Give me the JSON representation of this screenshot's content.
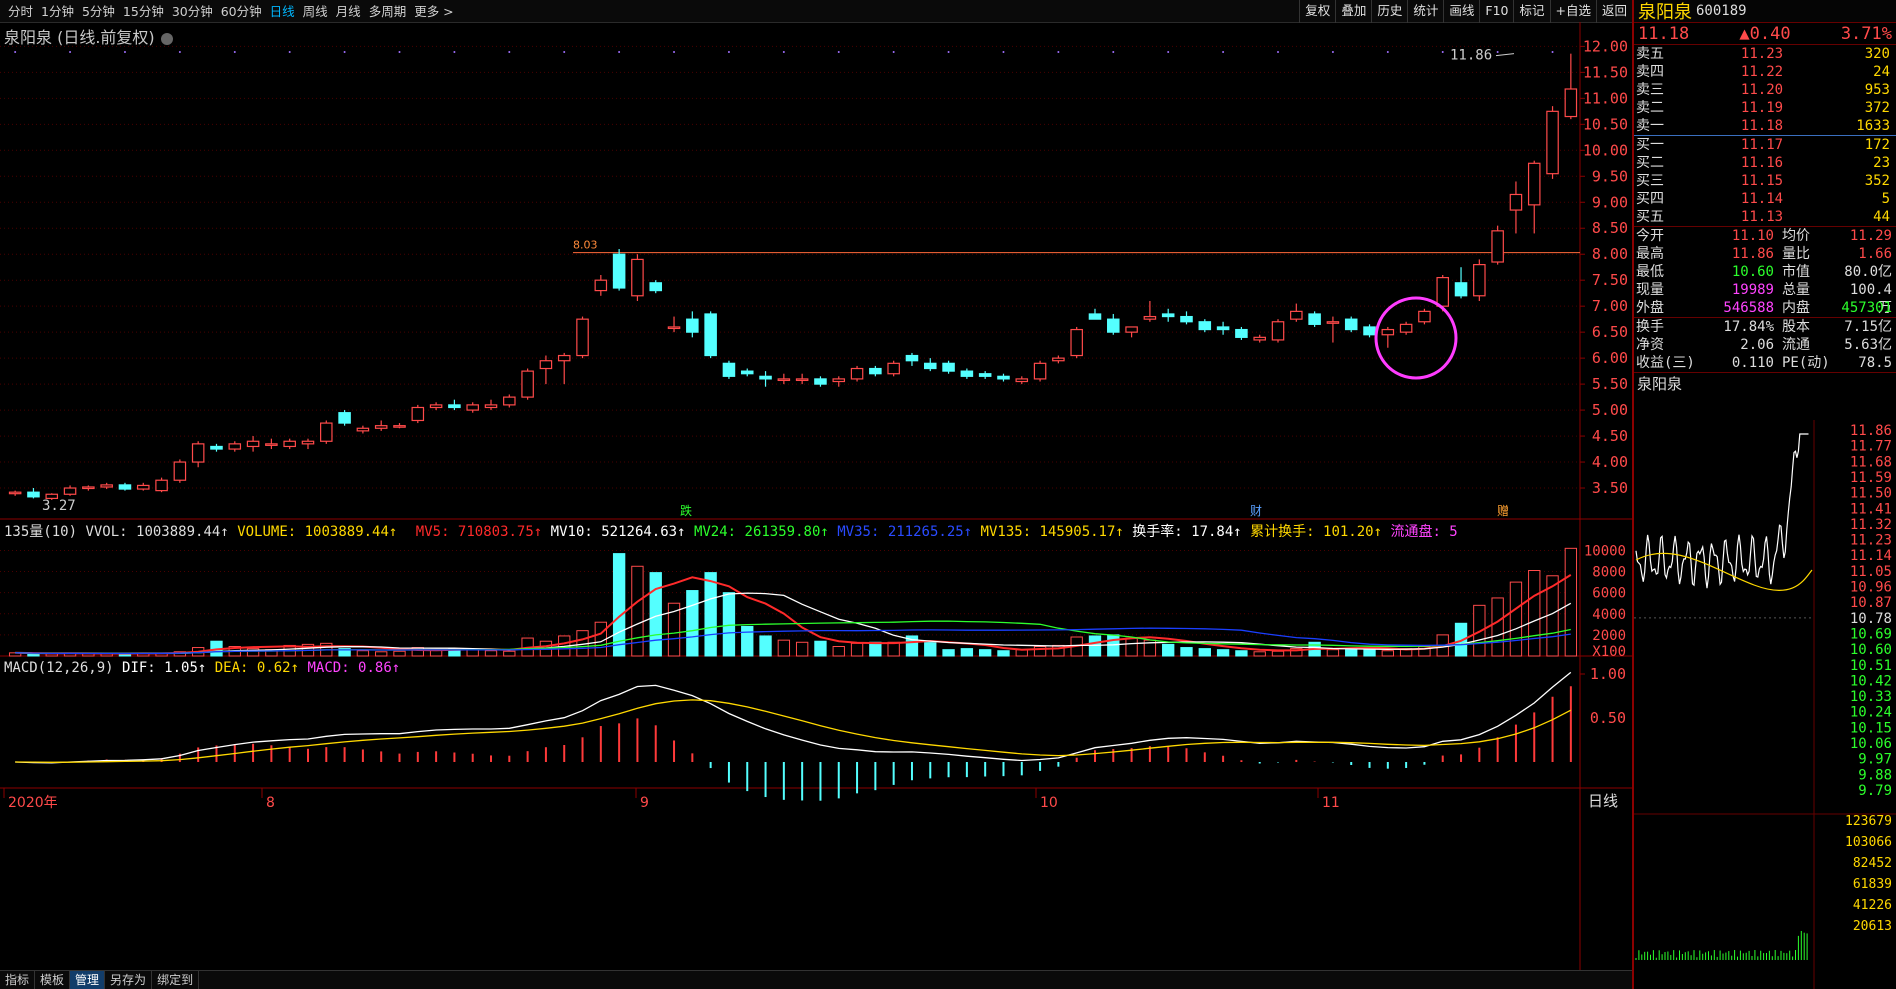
{
  "toolbar": {
    "periods": [
      "分时",
      "1分钟",
      "5分钟",
      "15分钟",
      "30分钟",
      "60分钟",
      "日线",
      "周线",
      "月线",
      "多周期",
      "更多"
    ],
    "active_period": "日线",
    "right_buttons": [
      "复权",
      "叠加",
      "历史",
      "统计",
      "画线",
      "F10",
      "标记",
      "+自选",
      "返回"
    ]
  },
  "chart_title": "泉阳泉 (日线.前复权)",
  "colors": {
    "up": "#ff4a4a",
    "down": "#54ffff",
    "ma5": "#ff2a2a",
    "ma10": "#ffffff",
    "ma24": "#2cff2c",
    "ma35": "#1a3fff",
    "ma135": "#ffd800",
    "macd": "#ff3a3a"
  },
  "price_axis": [
    "12.00",
    "11.50",
    "11.00",
    "10.50",
    "10.00",
    "9.50",
    "9.00",
    "8.50",
    "8.00",
    "7.50",
    "7.00",
    "6.50",
    "6.00",
    "5.50",
    "5.00",
    "4.50",
    "4.00",
    "3.50"
  ],
  "annotations": {
    "high_label": "11.86",
    "low_label": "3.27",
    "line_label": "8.03",
    "event_markers": [
      "跌",
      "财",
      "赠"
    ]
  },
  "volume_bar": {
    "name": "135量(10)",
    "vvol": "VVOL: 1003889.44↑",
    "volume": "VOLUME: 1003889.44↑",
    "mv5": "MV5: 710803.75↑",
    "mv10": "MV10: 521264.63↑",
    "mv24": "MV24: 261359.80↑",
    "mv35": "MV35: 211265.25↑",
    "mv135": "MV135: 145905.17↑",
    "turnover": "换手率: 17.84↑",
    "cum_turnover": "累计换手: 101.20↑",
    "float": "流通盘: 5"
  },
  "volume_axis": [
    "10000",
    "8000",
    "6000",
    "4000",
    "2000",
    "X100"
  ],
  "macd_bar": {
    "name": "MACD(12,26,9)",
    "dif": "DIF: 1.05↑",
    "dea": "DEA: 0.62↑",
    "macd": "MACD: 0.86↑"
  },
  "macd_axis": [
    "1.00",
    "0.50"
  ],
  "time_axis": [
    "2020年",
    "8",
    "9",
    "10",
    "11"
  ],
  "bottom_tabs": [
    "指标",
    "模板",
    "管理",
    "另存为",
    "绑定到"
  ],
  "period_label": "日线",
  "chart_data": {
    "type": "candlestick",
    "dates_start": "2020-07",
    "candles": [
      [
        3.4,
        3.45,
        3.35,
        3.42
      ],
      [
        3.42,
        3.5,
        3.3,
        3.33
      ],
      [
        3.3,
        3.4,
        3.27,
        3.38
      ],
      [
        3.38,
        3.55,
        3.35,
        3.5
      ],
      [
        3.5,
        3.55,
        3.45,
        3.52
      ],
      [
        3.52,
        3.6,
        3.48,
        3.56
      ],
      [
        3.56,
        3.6,
        3.45,
        3.48
      ],
      [
        3.48,
        3.6,
        3.45,
        3.55
      ],
      [
        3.45,
        3.7,
        3.42,
        3.65
      ],
      [
        3.65,
        4.05,
        3.6,
        4.0
      ],
      [
        4.0,
        4.4,
        3.9,
        4.35
      ],
      [
        4.3,
        4.35,
        4.2,
        4.25
      ],
      [
        4.25,
        4.4,
        4.2,
        4.35
      ],
      [
        4.3,
        4.5,
        4.2,
        4.4
      ],
      [
        4.35,
        4.45,
        4.25,
        4.35
      ],
      [
        4.3,
        4.45,
        4.25,
        4.4
      ],
      [
        4.35,
        4.45,
        4.25,
        4.4
      ],
      [
        4.4,
        4.8,
        4.35,
        4.75
      ],
      [
        4.95,
        5.0,
        4.7,
        4.75
      ],
      [
        4.6,
        4.7,
        4.55,
        4.65
      ],
      [
        4.65,
        4.8,
        4.6,
        4.7
      ],
      [
        4.7,
        4.75,
        4.65,
        4.7
      ],
      [
        4.8,
        5.1,
        4.75,
        5.05
      ],
      [
        5.05,
        5.15,
        5.0,
        5.1
      ],
      [
        5.1,
        5.2,
        5.0,
        5.05
      ],
      [
        5.0,
        5.15,
        4.95,
        5.1
      ],
      [
        5.05,
        5.2,
        5.0,
        5.1
      ],
      [
        5.1,
        5.3,
        5.05,
        5.25
      ],
      [
        5.25,
        5.8,
        5.2,
        5.75
      ],
      [
        5.8,
        6.05,
        5.5,
        5.95
      ],
      [
        5.95,
        6.1,
        5.5,
        6.05
      ],
      [
        6.05,
        6.8,
        6.0,
        6.75
      ],
      [
        7.3,
        7.6,
        7.2,
        7.5
      ],
      [
        8.0,
        8.1,
        7.3,
        7.35
      ],
      [
        7.2,
        8.0,
        7.1,
        7.9
      ],
      [
        7.45,
        7.5,
        7.25,
        7.3
      ],
      [
        6.6,
        6.8,
        6.5,
        6.6
      ],
      [
        6.75,
        6.9,
        6.4,
        6.5
      ],
      [
        6.85,
        6.9,
        6.0,
        6.05
      ],
      [
        5.9,
        5.95,
        5.6,
        5.65
      ],
      [
        5.75,
        5.8,
        5.65,
        5.7
      ],
      [
        5.65,
        5.75,
        5.45,
        5.6
      ],
      [
        5.6,
        5.7,
        5.5,
        5.6
      ],
      [
        5.6,
        5.7,
        5.5,
        5.6
      ],
      [
        5.6,
        5.65,
        5.45,
        5.5
      ],
      [
        5.55,
        5.65,
        5.45,
        5.6
      ],
      [
        5.6,
        5.85,
        5.55,
        5.8
      ],
      [
        5.8,
        5.85,
        5.65,
        5.7
      ],
      [
        5.7,
        5.95,
        5.65,
        5.9
      ],
      [
        6.05,
        6.1,
        5.85,
        5.95
      ],
      [
        5.9,
        6.0,
        5.75,
        5.8
      ],
      [
        5.9,
        5.95,
        5.7,
        5.75
      ],
      [
        5.75,
        5.8,
        5.6,
        5.65
      ],
      [
        5.7,
        5.75,
        5.6,
        5.65
      ],
      [
        5.65,
        5.7,
        5.55,
        5.6
      ],
      [
        5.55,
        5.65,
        5.5,
        5.6
      ],
      [
        5.6,
        5.95,
        5.55,
        5.9
      ],
      [
        5.95,
        6.05,
        5.9,
        6.0
      ],
      [
        6.05,
        6.6,
        6.0,
        6.55
      ],
      [
        6.85,
        6.95,
        6.75,
        6.75
      ],
      [
        6.75,
        6.85,
        6.45,
        6.5
      ],
      [
        6.5,
        6.6,
        6.4,
        6.6
      ],
      [
        6.75,
        7.1,
        6.7,
        6.8
      ],
      [
        6.85,
        6.95,
        6.7,
        6.8
      ],
      [
        6.8,
        6.9,
        6.65,
        6.7
      ],
      [
        6.7,
        6.75,
        6.5,
        6.55
      ],
      [
        6.6,
        6.7,
        6.45,
        6.55
      ],
      [
        6.55,
        6.6,
        6.35,
        6.4
      ],
      [
        6.35,
        6.45,
        6.3,
        6.4
      ],
      [
        6.35,
        6.75,
        6.3,
        6.7
      ],
      [
        6.75,
        7.05,
        6.7,
        6.9
      ],
      [
        6.85,
        6.9,
        6.6,
        6.65
      ],
      [
        6.7,
        6.8,
        6.3,
        6.7
      ],
      [
        6.75,
        6.8,
        6.5,
        6.55
      ],
      [
        6.6,
        6.65,
        6.4,
        6.45
      ],
      [
        6.45,
        6.6,
        6.2,
        6.55
      ],
      [
        6.5,
        6.7,
        6.45,
        6.65
      ],
      [
        6.7,
        6.95,
        6.65,
        6.9
      ],
      [
        7.0,
        7.6,
        6.9,
        7.55
      ],
      [
        7.45,
        7.75,
        7.15,
        7.2
      ],
      [
        7.2,
        7.9,
        7.1,
        7.8
      ],
      [
        7.85,
        8.55,
        7.8,
        8.45
      ],
      [
        8.85,
        9.4,
        8.4,
        9.15
      ],
      [
        8.95,
        9.8,
        8.4,
        9.75
      ],
      [
        9.55,
        10.85,
        9.45,
        10.75
      ],
      [
        10.65,
        11.86,
        10.6,
        11.18
      ]
    ],
    "volume": [
      300,
      250,
      200,
      280,
      220,
      240,
      260,
      230,
      280,
      400,
      800,
      1400,
      900,
      700,
      600,
      1000,
      1100,
      1200,
      700,
      500,
      400,
      450,
      800,
      600,
      700,
      600,
      500,
      450,
      1700,
      1400,
      1900,
      2400,
      3200,
      9700,
      8500,
      7900,
      5000,
      6200,
      7900,
      6000,
      2800,
      1900,
      1500,
      1300,
      1400,
      900,
      1200,
      1300,
      1300,
      1900,
      1400,
      600,
      700,
      600,
      500,
      600,
      900,
      1000,
      1800,
      1900,
      2000,
      1700,
      1500,
      1100,
      800,
      700,
      600,
      500,
      400,
      450,
      700,
      1300,
      600,
      700,
      600,
      500,
      700,
      900,
      2000,
      3100,
      4800,
      5500,
      7000,
      8100,
      7600,
      10200
    ],
    "ylim": [
      3.0,
      12.2
    ]
  },
  "quote": {
    "name": "泉阳泉",
    "code": "600189",
    "price": "11.18",
    "change": "▲0.40",
    "pct": "3.71%",
    "asks": [
      [
        "卖五",
        "11.23",
        "320"
      ],
      [
        "卖四",
        "11.22",
        "24"
      ],
      [
        "卖三",
        "11.20",
        "953"
      ],
      [
        "卖二",
        "11.19",
        "372"
      ],
      [
        "卖一",
        "11.18",
        "1633"
      ]
    ],
    "bids": [
      [
        "买一",
        "11.17",
        "172"
      ],
      [
        "买二",
        "11.16",
        "23"
      ],
      [
        "买三",
        "11.15",
        "352"
      ],
      [
        "买四",
        "11.14",
        "5"
      ],
      [
        "买五",
        "11.13",
        "44"
      ]
    ],
    "stats": [
      [
        "今开",
        "11.10",
        "均价",
        "11.29"
      ],
      [
        "最高",
        "11.86",
        "量比",
        "1.66"
      ],
      [
        "最低",
        "10.60",
        "市值",
        "80.0亿"
      ],
      [
        "现量",
        "19989",
        "总量",
        "100.4万"
      ],
      [
        "外盘",
        "546588",
        "内盘",
        "457301"
      ]
    ],
    "stats2": [
      [
        "换手",
        "17.84%",
        "股本",
        "7.15亿"
      ],
      [
        "净资",
        "2.06",
        "流通",
        "5.63亿"
      ],
      [
        "收益(三)",
        "0.110",
        "PE(动)",
        "78.5"
      ]
    ],
    "mini_title": "泉阳泉",
    "mini_axis": [
      "11.86",
      "11.77",
      "11.68",
      "11.59",
      "11.50",
      "11.41",
      "11.32",
      "11.23",
      "11.14",
      "11.05",
      "10.96",
      "10.87",
      "10.78",
      "10.69",
      "10.60",
      "10.51",
      "10.42",
      "10.33",
      "10.24",
      "10.15",
      "10.06",
      "9.97",
      "9.88",
      "9.79"
    ],
    "mini_vol_axis": [
      "123679",
      "103066",
      "82452",
      "61839",
      "41226",
      "20613"
    ]
  }
}
